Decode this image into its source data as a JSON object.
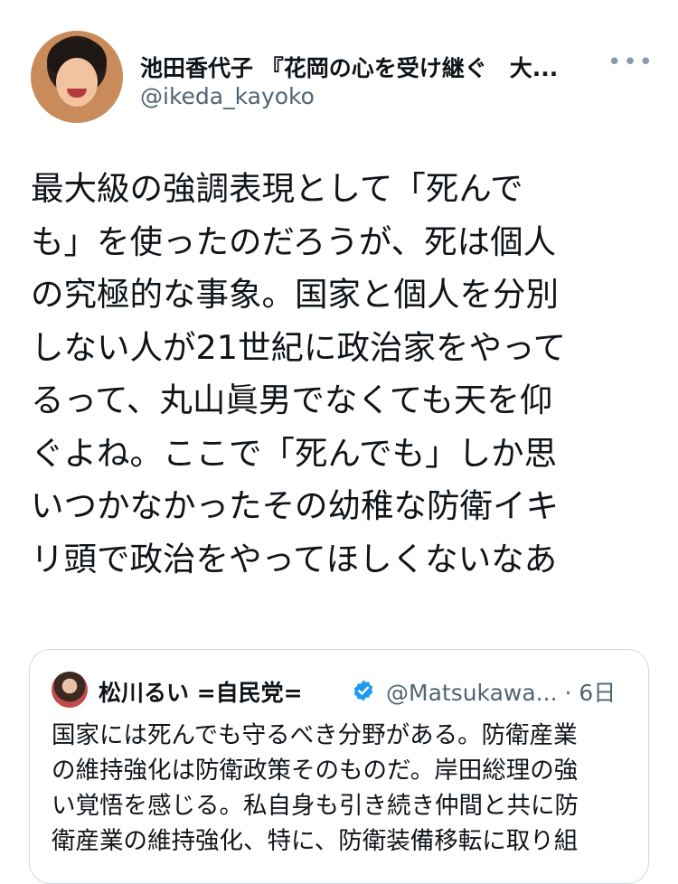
{
  "author": {
    "name": "池田香代子 『花岡の心を受け継ぐ　大...",
    "handle": "@ikeda_kayoko",
    "more_label": "•••"
  },
  "tweet": {
    "lines": [
      "最大級の強調表現として「死んで",
      "も」を使ったのだろうが、死は個人",
      "の究極的な事象。国家と個人を分別",
      "しない人が21世紀に政治家をやって",
      "るって、丸山眞男でなくても天を仰",
      "ぐよね。ここで「死んでも」しか思",
      "いつかなかったその幼稚な防衛イキ",
      "リ頭で政治をやってほしくないなあ"
    ]
  },
  "quoted_tweet": {
    "name": "松川るい =自民党=",
    "verified": true,
    "handle_time": "@Matsukawa... · 6日",
    "lines": [
      "国家には死んでも守るべき分野がある。防衛産業",
      "の維持強化は防衛政策そのものだ。岸田総理の強",
      "い覚悟を感じる。私自身も引き続き仲間と共に防",
      "衛産業の維持強化、特に、防衛装備移転に取り組"
    ]
  },
  "colors": {
    "text": "#0f1419",
    "secondary": "#536471",
    "border": "#cfd9de",
    "verified": "#1d9bf0"
  }
}
